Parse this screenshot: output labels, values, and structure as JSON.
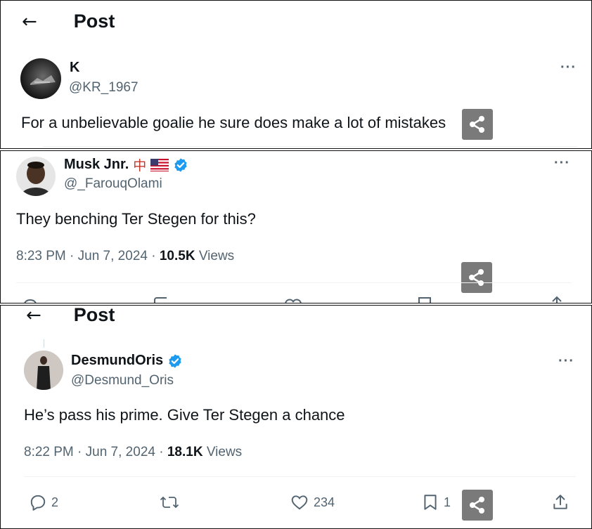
{
  "panels": [
    {
      "header": {
        "back_icon": "arrow-left-icon",
        "title": "Post"
      },
      "author": {
        "name": "K",
        "handle": "@KR_1967"
      },
      "text": "For a unbelievable goalie he sure does make a lot of mistakes"
    },
    {
      "author": {
        "name": "Musk Jnr.",
        "badge_char": "中",
        "handle": "@_FarouqOlami",
        "verified": true
      },
      "text": "They benching Ter Stegen for this?",
      "meta": {
        "time": "8:23 PM · Jun 7, 2024 · ",
        "views": "10.5K",
        "views_label": " Views"
      }
    },
    {
      "header": {
        "back_icon": "arrow-left-icon",
        "title": "Post"
      },
      "author": {
        "name": "DesmundOris",
        "handle": "@Desmund_Oris",
        "verified": true
      },
      "text": "He’s pass his prime. Give Ter Stegen a chance",
      "meta": {
        "time": "8:22 PM · Jun 7, 2024 · ",
        "views": "18.1K",
        "views_label": " Views"
      },
      "actions": {
        "replies": "2",
        "likes": "234",
        "bookmarks": "1"
      }
    }
  ],
  "more_label": "···",
  "colors": {
    "verified": "#1d9bf0",
    "muted": "#536471",
    "share_box": "#7a7a7a"
  }
}
